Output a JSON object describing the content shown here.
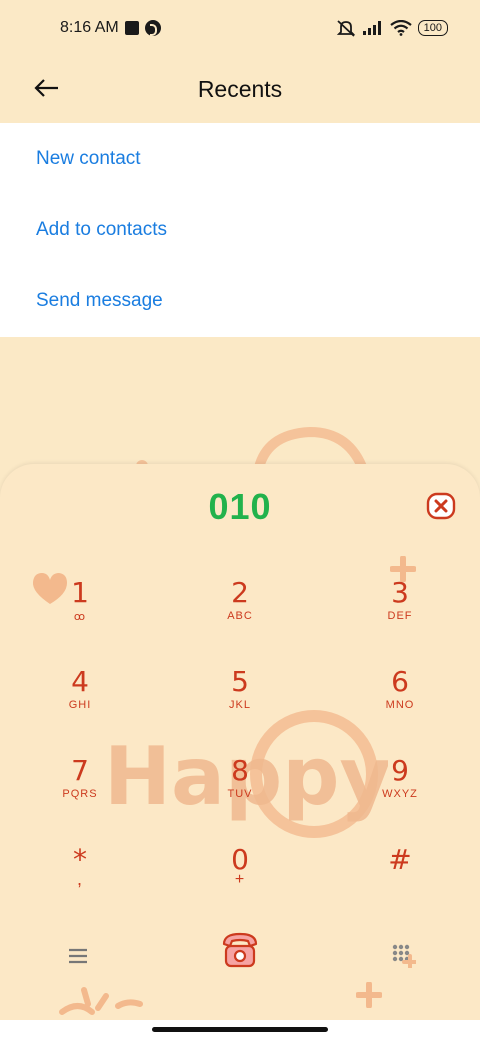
{
  "status_bar": {
    "time": "8:16 AM",
    "battery": "100",
    "icons": [
      "notification-square-icon",
      "app-circle-icon",
      "mute-icon",
      "signal-icon",
      "wifi-icon",
      "battery-icon"
    ]
  },
  "header": {
    "title": "Recents",
    "back_icon": "back-arrow-icon"
  },
  "menu": {
    "items": [
      {
        "label": "New contact"
      },
      {
        "label": "Add to contacts"
      },
      {
        "label": "Send message"
      }
    ]
  },
  "dialer": {
    "number": "010",
    "backspace_icon": "backspace-icon",
    "keys": [
      {
        "digit": "1",
        "letters": "ꝏ"
      },
      {
        "digit": "2",
        "letters": "ABC"
      },
      {
        "digit": "3",
        "letters": "DEF"
      },
      {
        "digit": "4",
        "letters": "GHI"
      },
      {
        "digit": "5",
        "letters": "JKL"
      },
      {
        "digit": "6",
        "letters": "MNO"
      },
      {
        "digit": "7",
        "letters": "PQRS"
      },
      {
        "digit": "8",
        "letters": "TUV"
      },
      {
        "digit": "9",
        "letters": "WXYZ"
      },
      {
        "digit": "*",
        "letters": ","
      },
      {
        "digit": "0",
        "letters": "+"
      },
      {
        "digit": "#",
        "letters": ""
      }
    ],
    "decoration_text": "Happy"
  },
  "bottom_bar": {
    "icons": [
      "menu-icon",
      "call-icon",
      "dialpad-grid-icon"
    ]
  },
  "colors": {
    "background": "#fbe9c6",
    "link": "#1a7de0",
    "number": "#22b24c",
    "key": "#cc3a1e",
    "decoration": "#f0b98f"
  }
}
